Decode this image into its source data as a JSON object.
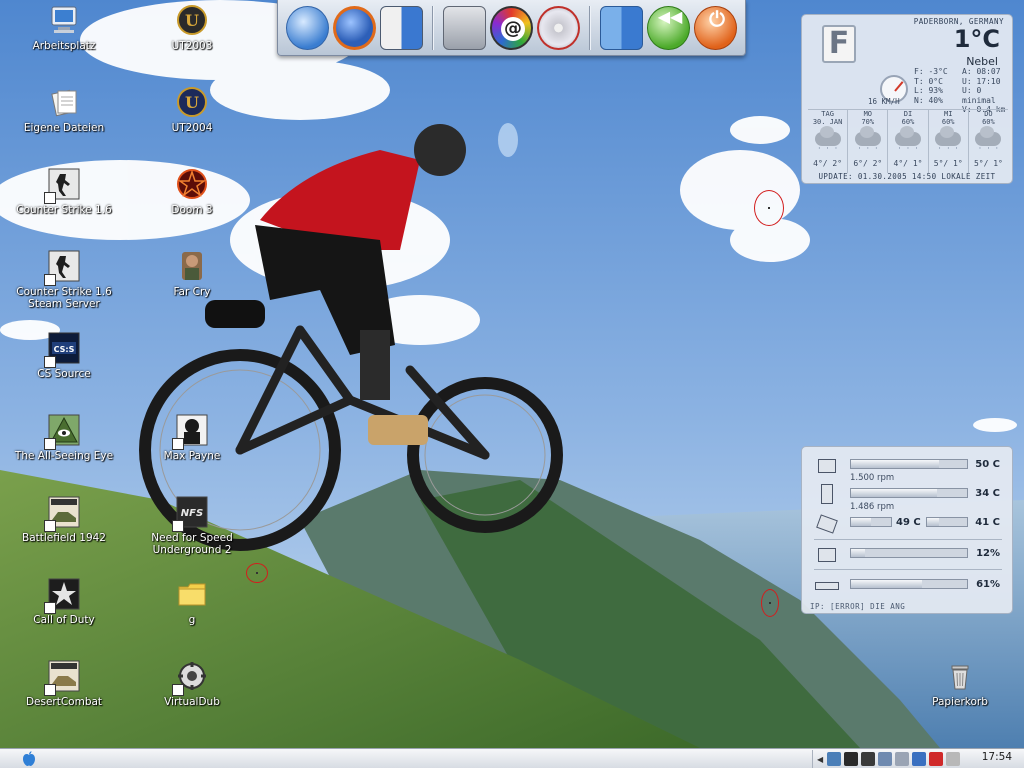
{
  "desktop_icons": [
    {
      "label": "Arbeitsplatz",
      "icon": "computer-icon"
    },
    {
      "label": "UT2003",
      "icon": "unreal-icon"
    },
    {
      "label": "Eigene Dateien",
      "icon": "documents-icon"
    },
    {
      "label": "UT2004",
      "icon": "unreal-icon"
    },
    {
      "label": "Counter Strike 1.6",
      "icon": "counter-strike-icon"
    },
    {
      "label": "Doom 3",
      "icon": "pentagram-icon"
    },
    {
      "label": "Counter Strike 1.6\nSteam Server",
      "icon": "counter-strike-icon"
    },
    {
      "label": "Far Cry",
      "icon": "far-cry-icon"
    },
    {
      "label": "CS Source",
      "icon": "cs-source-icon"
    },
    {
      "label": "The All-Seeing Eye",
      "icon": "all-seeing-eye-icon"
    },
    {
      "label": "Max Payne",
      "icon": "max-payne-icon"
    },
    {
      "label": "Battlefield 1942",
      "icon": "battlefield-icon"
    },
    {
      "label": "Need for Speed\nUnderground 2",
      "icon": "nfs-icon"
    },
    {
      "label": "g",
      "icon": "folder-icon"
    },
    {
      "label": "Call of Duty",
      "icon": "call-of-duty-icon"
    },
    {
      "label": "DesertCombat",
      "icon": "battlefield-icon"
    },
    {
      "label": "VirtualDub",
      "icon": "virtualdub-icon"
    },
    {
      "label": "Papierkorb",
      "icon": "trash-icon"
    }
  ],
  "dock": {
    "items": [
      {
        "name": "internet-explorer",
        "icon": "ie-globe-icon"
      },
      {
        "name": "firefox",
        "icon": "firefox-icon"
      },
      {
        "name": "messenger",
        "icon": "messenger-icon"
      },
      {
        "name": "hard-drive",
        "icon": "hard-drive-icon"
      },
      {
        "name": "mail",
        "icon": "mail-at-icon"
      },
      {
        "name": "nero",
        "icon": "nero-disc-icon"
      },
      {
        "name": "finder",
        "icon": "finder-icon"
      },
      {
        "name": "back",
        "icon": "back-arrow-icon"
      },
      {
        "name": "shutdown",
        "icon": "power-icon"
      }
    ]
  },
  "weather": {
    "location": "PADERBORN, GERMANY",
    "temperature": "1°C",
    "condition": "Nebel",
    "unit_badge": "F",
    "wind": "16 KM/H",
    "stats_left": [
      "F: -3°C",
      "T: 0°C",
      "L: 93%",
      "N: 40%"
    ],
    "stats_right": [
      "A: 08:07",
      "U: 17:10",
      "U: 0 minimal",
      "V: 0.4 km"
    ],
    "forecast": [
      {
        "day": "TAG",
        "sub": "30. JAN",
        "temp": "4°/ 2°"
      },
      {
        "day": "MO",
        "sub": "70%",
        "temp": "6°/ 2°"
      },
      {
        "day": "DI",
        "sub": "60%",
        "temp": "4°/ 1°"
      },
      {
        "day": "MI",
        "sub": "60%",
        "temp": "5°/ 1°"
      },
      {
        "day": "DO",
        "sub": "60%",
        "temp": "5°/ 1°"
      }
    ],
    "update": "UPDATE: 01.30.2005 14:50 LOKALE ZEIT"
  },
  "sysmon": {
    "rows": [
      {
        "value": "50 C",
        "sub": "1.500 rpm",
        "fill": 0.76
      },
      {
        "value": "34 C",
        "sub": "1.486 rpm",
        "fill": 0.74
      },
      {
        "value_a": "49 C",
        "value_b": "41 C",
        "fill_a": 0.5,
        "fill_b": 0.3
      },
      {
        "value": "12%",
        "fill": 0.12
      },
      {
        "value": "61%",
        "fill": 0.61
      }
    ],
    "ip": "IP: [ERROR] DIE ANG"
  },
  "taskbar": {
    "clock": "17:54"
  },
  "colors": {
    "accent": "#d21e1e",
    "sky": "#6f9bd6",
    "grass": "#5b8a3a"
  }
}
